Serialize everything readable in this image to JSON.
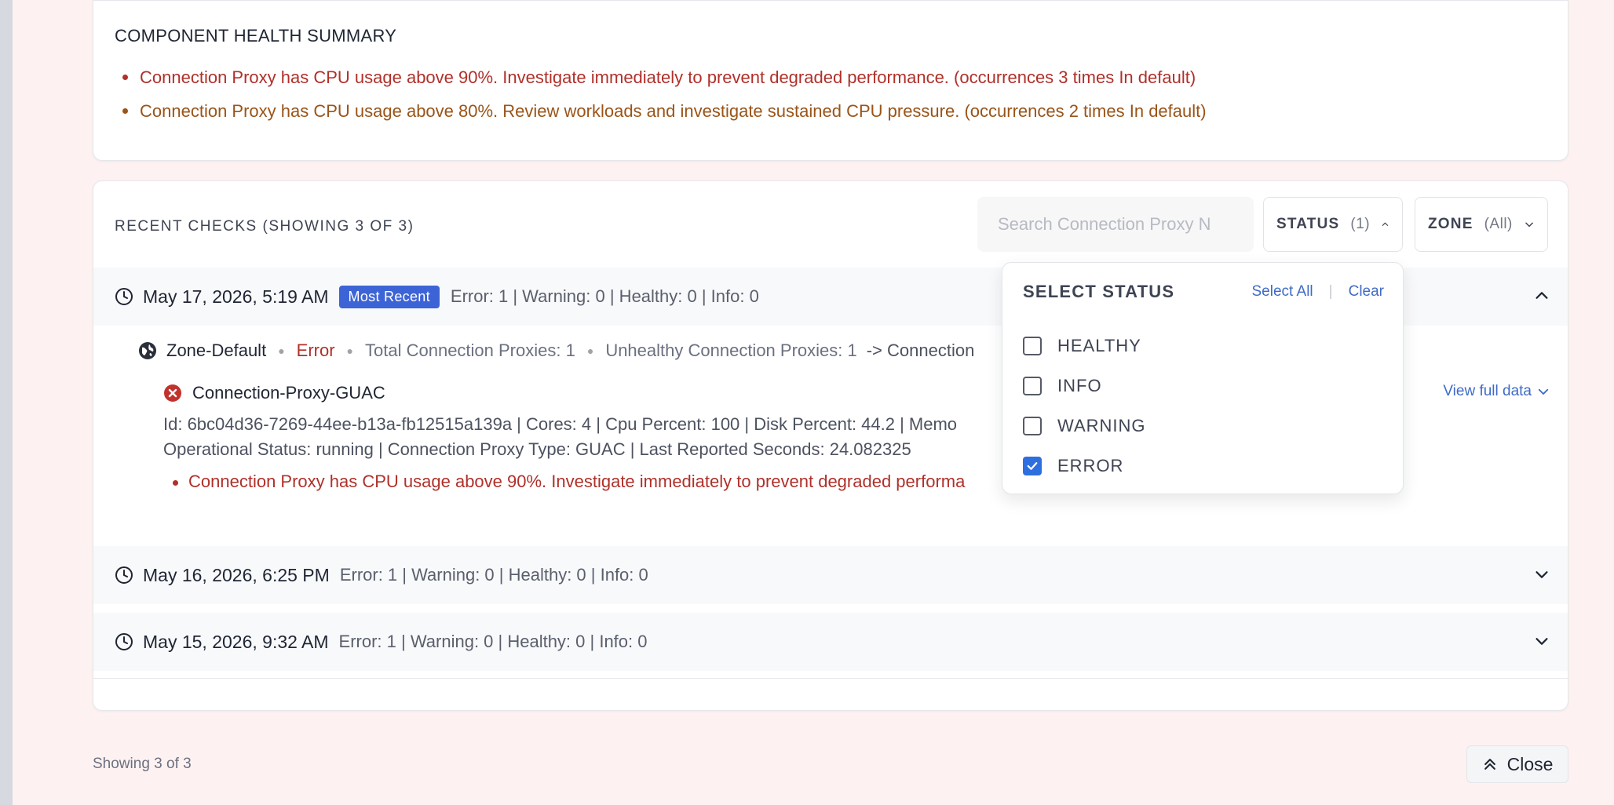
{
  "summary": {
    "title": "COMPONENT HEALTH SUMMARY",
    "items": [
      {
        "text": "Connection Proxy has CPU usage above 90%. Investigate immediately to prevent degraded performance. (occurrences 3 times In default)",
        "severity": "error"
      },
      {
        "text": "Connection Proxy has CPU usage above 80%. Review workloads and investigate sustained CPU pressure. (occurrences 2 times In default)",
        "severity": "warning"
      }
    ]
  },
  "checks": {
    "title": "RECENT CHECKS (SHOWING 3 OF 3)",
    "search_placeholder": "Search Connection Proxy N",
    "status_filter": {
      "label": "STATUS",
      "count": "(1)"
    },
    "zone_filter": {
      "label": "ZONE",
      "count": "(All)"
    },
    "items": [
      {
        "date": "May 17, 2026, 5:19 AM",
        "badge": "Most Recent",
        "counts": "Error: 1 | Warning: 0 | Healthy: 0 | Info: 0",
        "expanded": true,
        "zone": {
          "name": "Zone-Default",
          "status": "Error",
          "total": "Total Connection Proxies: 1",
          "unhealthy": "Unhealthy Connection Proxies: 1",
          "arrow_text": "-> Connection"
        },
        "proxy": {
          "name": "Connection-Proxy-GUAC",
          "details_line1": "Id: 6bc04d36-7269-44ee-b13a-fb12515a139a | Cores: 4 | Cpu Percent: 100 | Disk Percent: 44.2 | Memo",
          "details_line2": "Operational Status: running | Connection Proxy Type: GUAC | Last Reported Seconds: 24.082325",
          "issue": "Connection Proxy has CPU usage above 90%. Investigate immediately to prevent degraded performa",
          "view_full_label": "View full data"
        }
      },
      {
        "date": "May 16, 2026, 6:25 PM",
        "counts": "Error: 1 | Warning: 0 | Healthy: 0 | Info: 0",
        "expanded": false
      },
      {
        "date": "May 15, 2026, 9:32 AM",
        "counts": "Error: 1 | Warning: 0 | Healthy: 0 | Info: 0",
        "expanded": false
      }
    ]
  },
  "status_dropdown": {
    "title": "SELECT STATUS",
    "select_all": "Select All",
    "separator": "|",
    "clear": "Clear",
    "options": [
      {
        "label": "HEALTHY",
        "checked": false
      },
      {
        "label": "INFO",
        "checked": false
      },
      {
        "label": "WARNING",
        "checked": false
      },
      {
        "label": "ERROR",
        "checked": true
      }
    ]
  },
  "footer": {
    "showing": "Showing 3 of 3",
    "close_label": "Close"
  },
  "colors": {
    "error": "#b0302a",
    "warning": "#9a5418",
    "accent": "#3d64d6",
    "link": "#3e6bc7"
  }
}
